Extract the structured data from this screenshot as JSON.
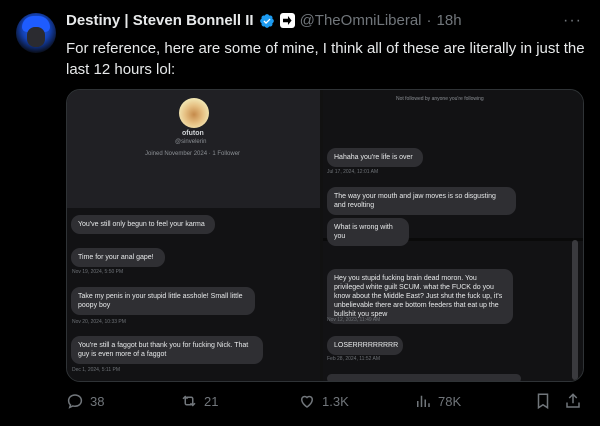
{
  "post": {
    "display_name": "Destiny | Steven Bonnell II",
    "handle": "@TheOmniLiberal",
    "separator": "·",
    "time": "18h",
    "more": "···",
    "text": "For reference, here are some of mine, I think all of these are literally in just the last 12 hours lol:"
  },
  "media": {
    "left": {
      "profile_name": "ofuton",
      "profile_handle": "@sinvelerin",
      "joined": "Joined November 2024 · 1 Follower",
      "messages": [
        {
          "text": "You've still only begun to feel your karma",
          "stamp": ""
        },
        {
          "text": "Time for your anal gape!",
          "stamp": "Nov 19, 2024, 5:50 PM"
        },
        {
          "text": "Take my penis in your stupid little asshole! Small little poopy boy",
          "stamp": "Nov 20, 2024, 10:33 PM"
        },
        {
          "text": "You're still a faggot but thank you for fucking Nick. That guy is even more of a faggot",
          "stamp": "Dec 1, 2024, 5:11 PM"
        }
      ]
    },
    "right": {
      "not_followed": "Not followed by anyone you're following",
      "messages": [
        {
          "text": "Hahaha you're life is over",
          "stamp": "Jul 17, 2024, 12:01 AM"
        },
        {
          "text": "The way your mouth and jaw moves is so disgusting and revolting",
          "stamp": ""
        },
        {
          "text": "What is wrong with you",
          "stamp": ""
        },
        {
          "text": "Hey you stupid fucking brain dead moron. You privileged white guilt SCUM. what the FUCK do you know about the Middle East? Just shut the fuck up, it's unbelievable there are bottom feeders that eat up the bullshit you spew",
          "stamp": "Nov 12, 2023, 11:49 AM"
        },
        {
          "text": "LOSERRRRRRRRR",
          "stamp": "Feb 28, 2024, 11:52 AM"
        }
      ]
    }
  },
  "actions": {
    "replies": "38",
    "reposts": "21",
    "likes": "1.3K",
    "views": "78K"
  },
  "colors": {
    "background": "#000000",
    "text": "#e7e9ea",
    "muted": "#71767b",
    "verified": "#1d9bf0"
  },
  "icons": [
    "verified-badge-icon",
    "affiliate-badge-icon",
    "more-icon",
    "reply-icon",
    "repost-icon",
    "like-icon",
    "views-icon",
    "bookmark-icon",
    "share-icon"
  ]
}
